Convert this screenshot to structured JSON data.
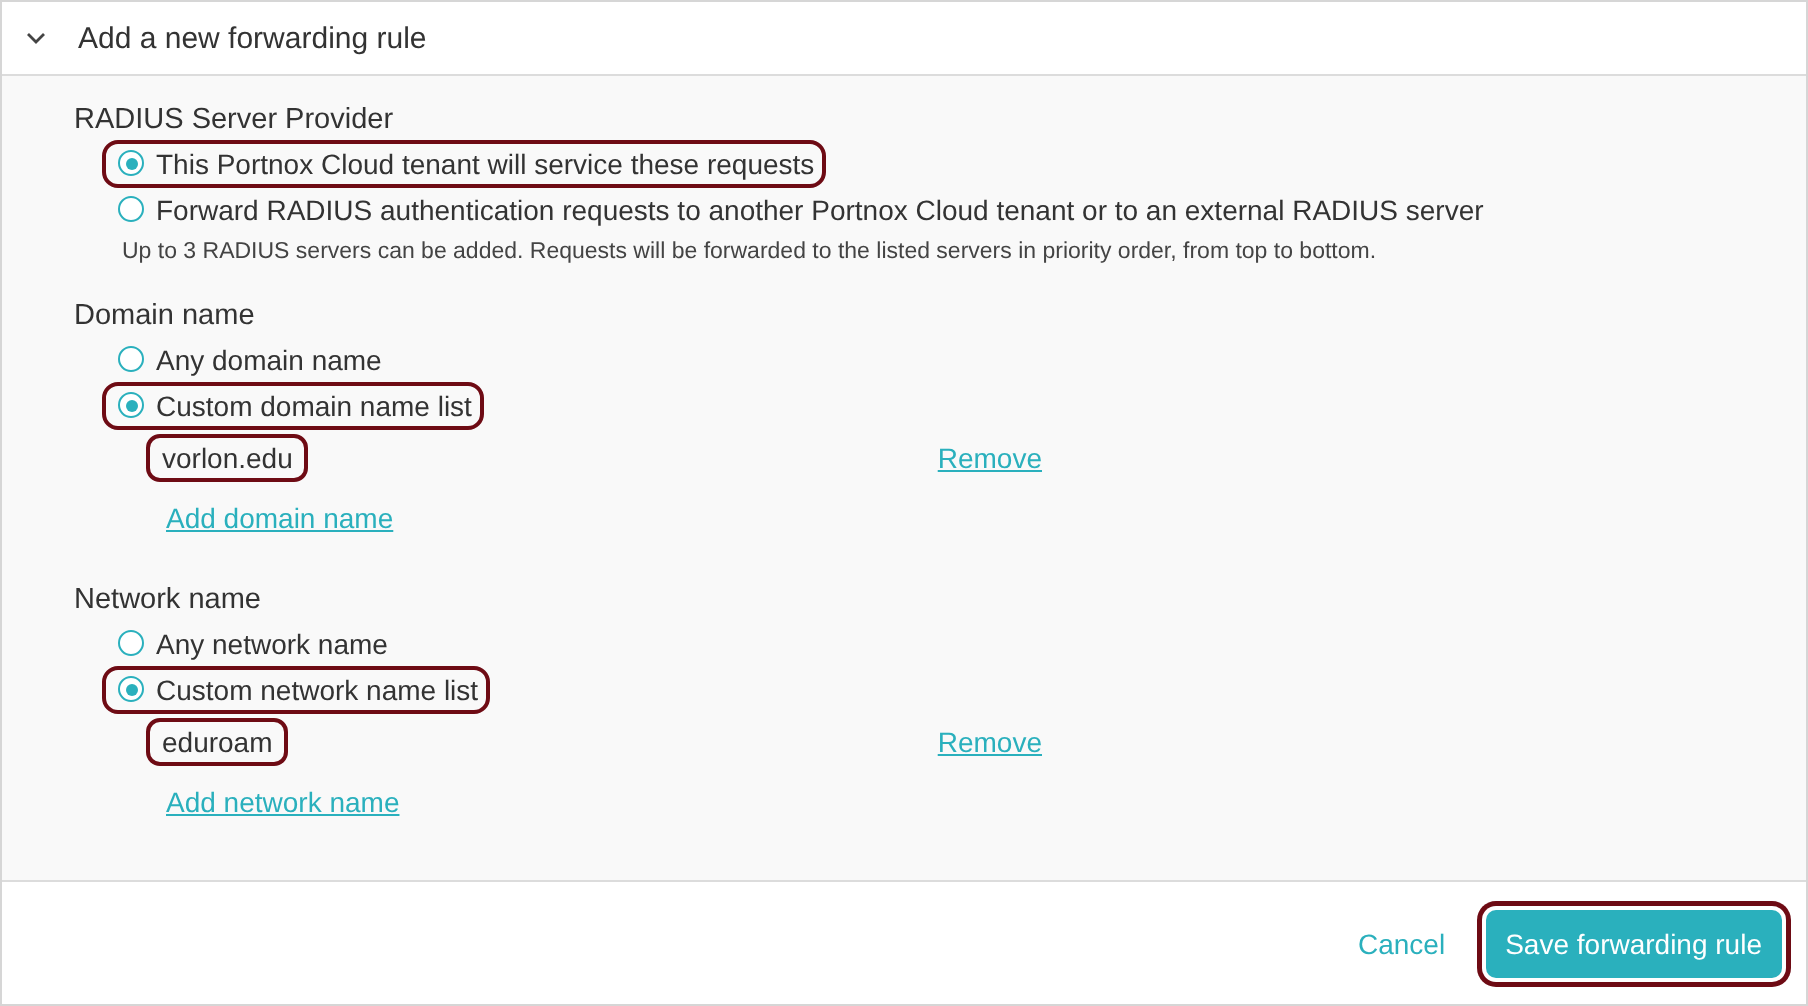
{
  "header": {
    "title": "Add a new forwarding rule",
    "expanded": true
  },
  "sections": [
    {
      "label": "RADIUS Server Provider",
      "options": [
        {
          "label": "This Portnox Cloud tenant will service these requests",
          "selected": true,
          "highlighted": true
        },
        {
          "label": "Forward RADIUS authentication requests to another Portnox Cloud tenant or to an external RADIUS server",
          "selected": false,
          "highlighted": false
        }
      ],
      "note": "Up to 3 RADIUS servers can be added. Requests will be forwarded to the listed servers in priority order, from top to bottom."
    },
    {
      "label": "Domain name",
      "options": [
        {
          "label": "Any domain name",
          "selected": false,
          "highlighted": false
        },
        {
          "label": "Custom domain name list",
          "selected": true,
          "highlighted": true
        }
      ],
      "entries": [
        {
          "value": "vorlon.edu",
          "highlighted": true,
          "remove": "Remove"
        }
      ],
      "add_link": "Add domain name"
    },
    {
      "label": "Network name",
      "options": [
        {
          "label": "Any network name",
          "selected": false,
          "highlighted": false
        },
        {
          "label": "Custom network name list",
          "selected": true,
          "highlighted": true
        }
      ],
      "entries": [
        {
          "value": "eduroam",
          "highlighted": true,
          "remove": "Remove"
        }
      ],
      "add_link": "Add network name"
    }
  ],
  "footer": {
    "cancel": "Cancel",
    "save": {
      "label": "Save forwarding rule",
      "highlighted": true
    }
  }
}
